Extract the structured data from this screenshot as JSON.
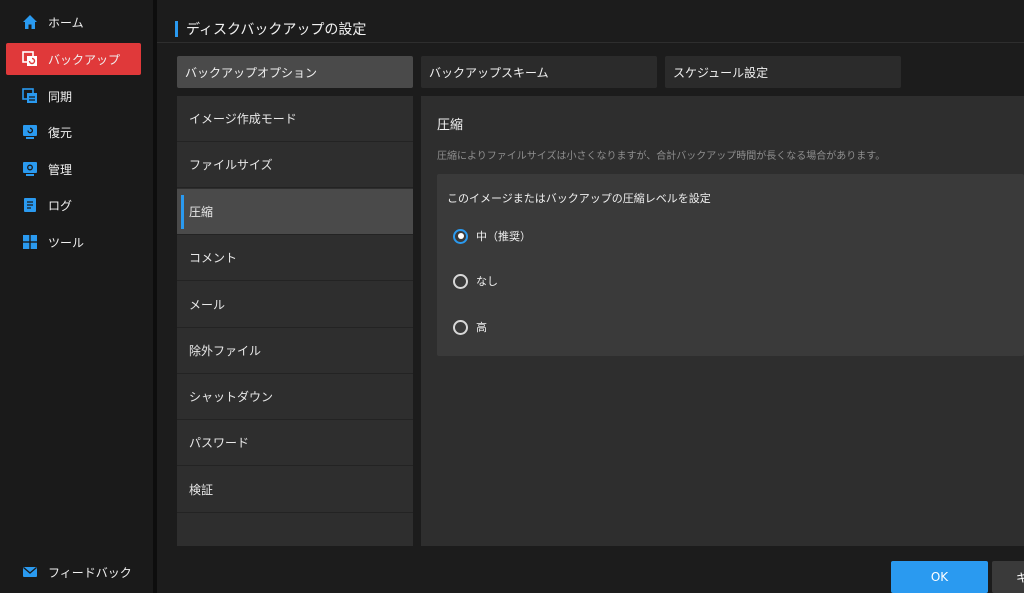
{
  "sidebar": {
    "items": [
      {
        "label": "ホーム",
        "icon": "home-icon"
      },
      {
        "label": "バックアップ",
        "icon": "backup-icon"
      },
      {
        "label": "同期",
        "icon": "sync-icon"
      },
      {
        "label": "復元",
        "icon": "restore-icon"
      },
      {
        "label": "管理",
        "icon": "manage-icon"
      },
      {
        "label": "ログ",
        "icon": "log-icon"
      },
      {
        "label": "ツール",
        "icon": "tools-icon"
      }
    ],
    "feedback": {
      "label": "フィードバック",
      "icon": "mail-icon"
    }
  },
  "header": {
    "title": "ディスクバックアップの設定"
  },
  "tabs": [
    {
      "label": "バックアップオプション"
    },
    {
      "label": "バックアップスキーム"
    },
    {
      "label": "スケジュール設定"
    }
  ],
  "options": [
    {
      "label": "イメージ作成モード"
    },
    {
      "label": "ファイルサイズ"
    },
    {
      "label": "圧縮"
    },
    {
      "label": "コメント"
    },
    {
      "label": "メール"
    },
    {
      "label": "除外ファイル"
    },
    {
      "label": "シャットダウン"
    },
    {
      "label": "パスワード"
    },
    {
      "label": "検証"
    }
  ],
  "content": {
    "title": "圧縮",
    "description": "圧縮によりファイルサイズは小さくなりますが、合計バックアップ時間が長くなる場合があります。",
    "level_title": "このイメージまたはバックアップの圧縮レベルを設定",
    "levels": [
      {
        "label": "中（推奨）",
        "checked": true
      },
      {
        "label": "なし",
        "checked": false
      },
      {
        "label": "高",
        "checked": false
      }
    ]
  },
  "footer": {
    "ok_label": "OK",
    "cancel_label": "キ"
  },
  "colors": {
    "accent": "#2a9af0",
    "active_nav": "#e0393a"
  }
}
